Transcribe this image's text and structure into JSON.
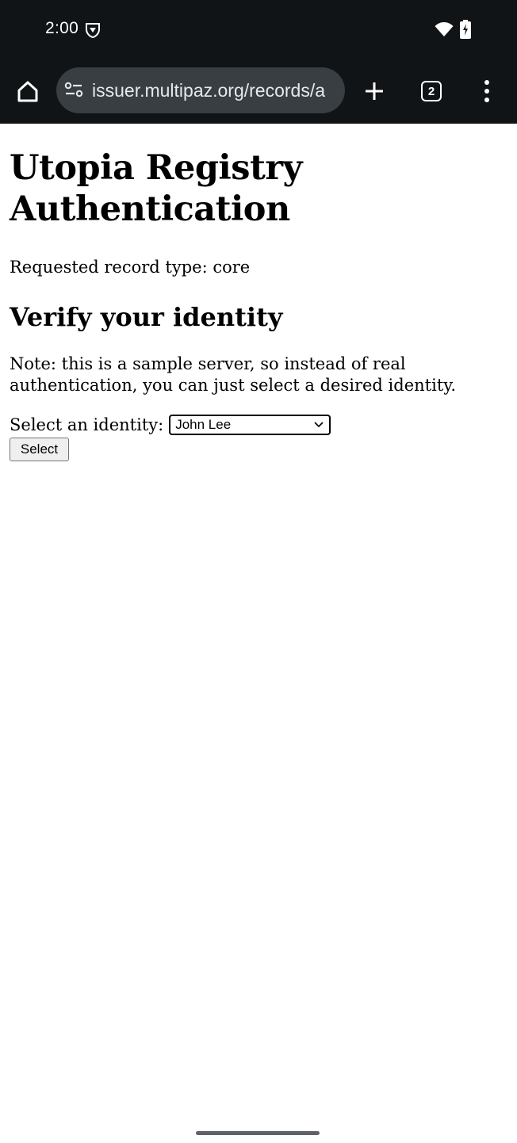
{
  "status_bar": {
    "time": "2:00",
    "icons": [
      "vpn-shield-icon",
      "wifi-icon",
      "battery-charging-icon"
    ]
  },
  "browser": {
    "url": "issuer.multipaz.org/records/a",
    "tab_count": "2",
    "icons": [
      "home-icon",
      "site-info-icon",
      "plus-icon",
      "menu-dots-icon"
    ]
  },
  "page": {
    "title": "Utopia Registry Authentication",
    "record_type_text": "Requested record type: core",
    "section_heading": "Verify your identity",
    "note": "Note: this is a sample server, so instead of real authentication, you can just select a desired identity.",
    "identity_label": "Select an identity:",
    "identity_selected": "John Lee",
    "select_button_label": "Select"
  }
}
